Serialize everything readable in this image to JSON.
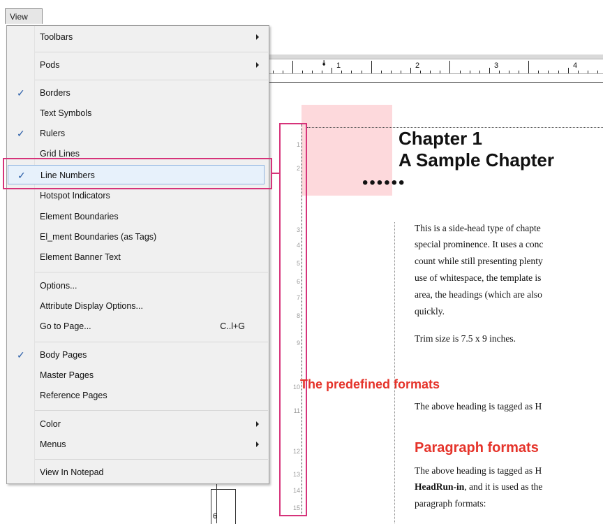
{
  "menubar": {
    "view_label": "View"
  },
  "ruler": {
    "labels": [
      "1",
      "2",
      "3",
      "4"
    ]
  },
  "vruler": {
    "label": "6"
  },
  "document": {
    "chapter_line1": "Chapter 1",
    "chapter_line2": "A Sample Chapter",
    "dots": "••••••",
    "para1": [
      "This is a side-head type of chapte",
      "special prominence. It uses a conc",
      "count while still presenting plenty",
      "use of whitespace, the template is",
      "area, the headings (which are also",
      "quickly."
    ],
    "trim": "Trim size is 7.5 x 9 inches.",
    "head_predefined": "The predefined formats",
    "line11": "The above heading is tagged as H",
    "head_paragraph": "Paragraph formats",
    "line13": "The above heading is tagged as H",
    "line14_bold": "HeadRun-in",
    "line14_rest": ", and it is used as the",
    "line15": "paragraph formats:"
  },
  "line_numbers": [
    "1",
    "2",
    "3",
    "4",
    "5",
    "6",
    "7",
    "8",
    "9",
    "10",
    "11",
    "12",
    "13",
    "14",
    "15"
  ],
  "menu": {
    "items": [
      {
        "label": "Toolbars",
        "checked": false,
        "submenu": true
      },
      {
        "label": "Pods",
        "checked": false,
        "submenu": true
      },
      {
        "label": "Borders",
        "checked": true
      },
      {
        "label": "Text Symbols",
        "checked": false
      },
      {
        "label": "Rulers",
        "checked": true
      },
      {
        "label": "Grid Lines",
        "checked": false
      },
      {
        "label": "Line Numbers",
        "checked": true,
        "highlighted": true
      },
      {
        "label": "Hotspot Indicators",
        "checked": false
      },
      {
        "label": "Element Boundaries",
        "checked": false
      },
      {
        "label": "El_ment Boundaries (as Tags)",
        "checked": false
      },
      {
        "label": "Element Banner Text",
        "checked": false
      },
      {
        "label": "Options...",
        "checked": false
      },
      {
        "label": "Attribute Display Options...",
        "checked": false
      },
      {
        "label": "Go to Page...",
        "checked": false,
        "shortcut": "C..l+G"
      },
      {
        "label": "Body Pages",
        "checked": true
      },
      {
        "label": "Master Pages",
        "checked": false
      },
      {
        "label": "Reference Pages",
        "checked": false
      },
      {
        "label": "Color",
        "checked": false,
        "submenu": true
      },
      {
        "label": "Menus",
        "checked": false,
        "submenu": true
      },
      {
        "label": "View In Notepad",
        "checked": false
      }
    ],
    "check_glyph": "✓"
  },
  "colors": {
    "heading_red": "#e5332a",
    "highlight_pink": "#d6337a",
    "check_blue": "#2a5ea8"
  }
}
